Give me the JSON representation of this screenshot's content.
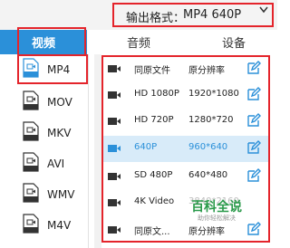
{
  "output_format": {
    "label": "输出格式：",
    "value": "MP4  640P"
  },
  "tabs": [
    {
      "label": "视频",
      "active": true
    },
    {
      "label": "音频",
      "active": false
    },
    {
      "label": "设备",
      "active": false
    }
  ],
  "sidebar": {
    "items": [
      {
        "label": "MP4",
        "icon": "mp4-file-icon",
        "selected": true
      },
      {
        "label": "MOV",
        "icon": "mov-file-icon"
      },
      {
        "label": "MKV",
        "icon": "mkv-file-icon"
      },
      {
        "label": "AVI",
        "icon": "avi-file-icon"
      },
      {
        "label": "WMV",
        "icon": "wmv-file-icon"
      },
      {
        "label": "M4V",
        "icon": "m4v-file-icon"
      }
    ]
  },
  "presets": [
    {
      "name": "同原文件",
      "resolution": "原分辨率"
    },
    {
      "name": "HD 1080P",
      "resolution": "1920*1080"
    },
    {
      "name": "HD 720P",
      "resolution": "1280*720"
    },
    {
      "name": "640P",
      "resolution": "960*640",
      "selected": true
    },
    {
      "name": "SD 480P",
      "resolution": "640*480"
    },
    {
      "name": "4K Video",
      "resolution": "3840*2160"
    },
    {
      "name": "同原文...",
      "resolution": "原分辨率"
    }
  ],
  "watermark": {
    "title": "百科全说",
    "subtitle": "助你轻松解决"
  },
  "colors": {
    "accent": "#2b90d9",
    "highlight_outline": "#e4242b",
    "selected_row": "#d8ebf9"
  }
}
